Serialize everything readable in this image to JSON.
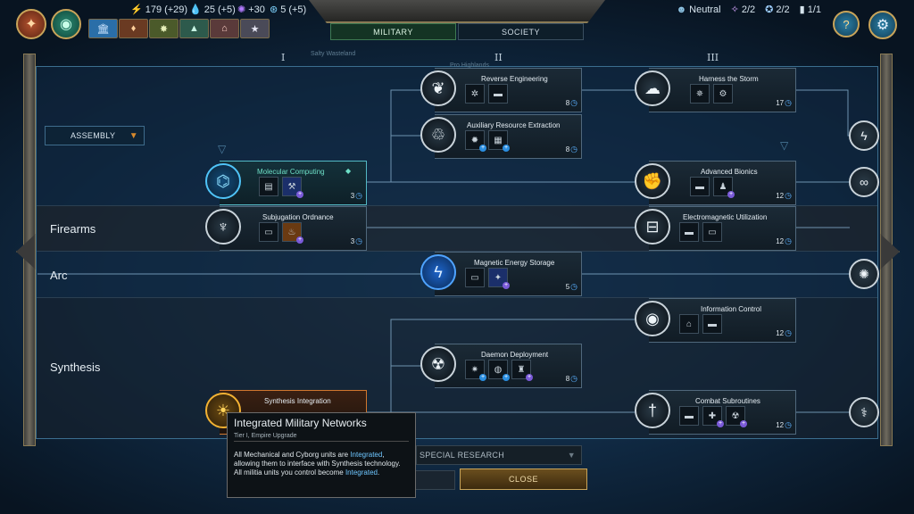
{
  "topbar": {
    "resources": [
      {
        "id": "energy",
        "icon": "lightning-icon",
        "value": "179",
        "delta": "(+29)"
      },
      {
        "id": "water",
        "icon": "water-drop-icon",
        "value": "25",
        "delta": "(+5)"
      },
      {
        "id": "influence",
        "icon": "influence-icon",
        "value": "+30",
        "delta": ""
      },
      {
        "id": "research",
        "icon": "research-icon",
        "value": "5",
        "delta": "(+5)"
      }
    ],
    "tabs": {
      "military": "MILITARY",
      "society": "SOCIETY"
    },
    "status": {
      "stance": "Neutral",
      "slot_a": "2/2",
      "slot_b": "2/2",
      "slot_c": "1/1"
    }
  },
  "tiers": [
    "I",
    "II",
    "III"
  ],
  "map_labels": {
    "wasteland": "Salty Wasteland",
    "highlands": "Pro Highlands"
  },
  "assembly_dropdown": "ASSEMBLY",
  "lanes": {
    "firearms": "Firearms",
    "arc": "Arc",
    "synthesis": "Synthesis"
  },
  "techs": {
    "molecular_computing": {
      "name": "Molecular Computing",
      "cost": "3"
    },
    "subjugation_ordnance": {
      "name": "Subjugation Ordnance",
      "cost": "3"
    },
    "synthesis_integration": {
      "name": "Synthesis Integration"
    },
    "reverse_engineering": {
      "name": "Reverse Engineering",
      "cost": "8"
    },
    "auxiliary_resource_extraction": {
      "name": "Auxiliary Resource Extraction",
      "cost": "8"
    },
    "magnetic_energy_storage": {
      "name": "Magnetic Energy Storage",
      "cost": "5"
    },
    "daemon_deployment": {
      "name": "Daemon Deployment",
      "cost": "8"
    },
    "harness_the_storm": {
      "name": "Harness the Storm",
      "cost": "17"
    },
    "advanced_bionics": {
      "name": "Advanced Bionics",
      "cost": "12"
    },
    "electromagnetic_utilization": {
      "name": "Electromagnetic Utilization",
      "cost": "12"
    },
    "information_control": {
      "name": "Information Control",
      "cost": "12"
    },
    "combat_subroutines": {
      "name": "Combat Subroutines",
      "cost": "12"
    }
  },
  "tooltip": {
    "title": "Integrated Military Networks",
    "subtitle": "Tier I, Empire Upgrade",
    "body_part1": "All Mechanical and Cyborg units are ",
    "keyword1": "Integrated",
    "body_part2": ", allowing them to interface with Synthesis technology.",
    "body_part3": "All militia units you control become ",
    "keyword2": "Integrated",
    "body_part4": "."
  },
  "special_research": "SPECIAL RESEARCH",
  "close_button": "CLOSE",
  "colors": {
    "accent_gold": "#c8a45a",
    "selected_teal": "#4fc3f7",
    "highlight_orange": "#d0772e"
  }
}
